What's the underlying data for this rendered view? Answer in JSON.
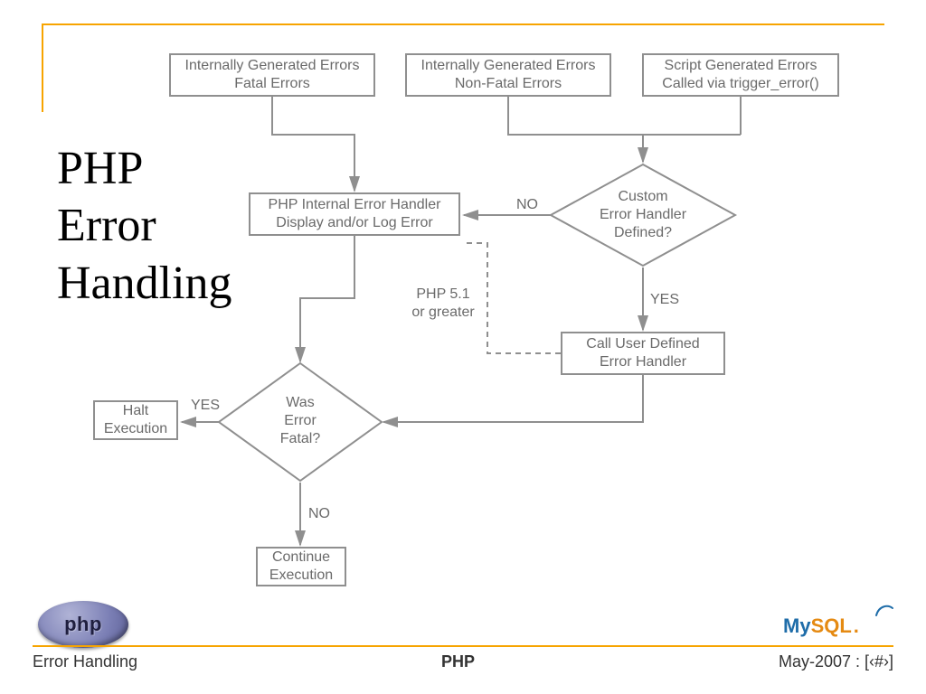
{
  "title_line1": "PHP",
  "title_line2": "Error",
  "title_line3": "Handling",
  "nodes": {
    "int_fatal_l1": "Internally Generated Errors",
    "int_fatal_l2": "Fatal Errors",
    "int_nonfatal_l1": "Internally Generated Errors",
    "int_nonfatal_l2": "Non-Fatal Errors",
    "script_l1": "Script Generated Errors",
    "script_l2": "Called via trigger_error()",
    "custom_l1": "Custom",
    "custom_l2": "Error Handler",
    "custom_l3": "Defined?",
    "internal_handler_l1": "PHP Internal Error Handler",
    "internal_handler_l2": "Display and/or Log Error",
    "call_user_l1": "Call User Defined",
    "call_user_l2": "Error Handler",
    "was_fatal_l1": "Was",
    "was_fatal_l2": "Error",
    "was_fatal_l3": "Fatal?",
    "halt": "Halt",
    "halt_l2": "Execution",
    "continue": "Continue",
    "continue_l2": "Execution"
  },
  "labels": {
    "no1": "NO",
    "yes1": "YES",
    "yes2": "YES",
    "no2": "NO",
    "php51_l1": "PHP 5.1",
    "php51_l2": "or greater"
  },
  "logos": {
    "php": "php",
    "mysql_my": "My",
    "mysql_sql": "SQL"
  },
  "footer": {
    "left": "Error Handling",
    "center": "PHP",
    "right": "May-2007 : [‹#›]"
  },
  "chart_data": {
    "type": "flowchart",
    "title": "PHP Error Handling",
    "nodes": [
      {
        "id": "n1",
        "type": "process",
        "label": "Internally Generated Errors — Fatal Errors"
      },
      {
        "id": "n2",
        "type": "process",
        "label": "Internally Generated Errors — Non-Fatal Errors"
      },
      {
        "id": "n3",
        "type": "process",
        "label": "Script Generated Errors — Called via trigger_error()"
      },
      {
        "id": "n4",
        "type": "decision",
        "label": "Custom Error Handler Defined?"
      },
      {
        "id": "n5",
        "type": "process",
        "label": "PHP Internal Error Handler — Display and/or Log Error"
      },
      {
        "id": "n6",
        "type": "process",
        "label": "Call User Defined Error Handler"
      },
      {
        "id": "n7",
        "type": "decision",
        "label": "Was Error Fatal?"
      },
      {
        "id": "n8",
        "type": "terminator",
        "label": "Halt Execution"
      },
      {
        "id": "n9",
        "type": "terminator",
        "label": "Continue Execution"
      }
    ],
    "edges": [
      {
        "from": "n1",
        "to": "n5",
        "label": ""
      },
      {
        "from": "n2",
        "to": "n4",
        "label": ""
      },
      {
        "from": "n3",
        "to": "n4",
        "label": ""
      },
      {
        "from": "n4",
        "to": "n5",
        "label": "NO"
      },
      {
        "from": "n4",
        "to": "n6",
        "label": "YES"
      },
      {
        "from": "n6",
        "to": "n5",
        "label": "PHP 5.1 or greater",
        "style": "dashed"
      },
      {
        "from": "n5",
        "to": "n7",
        "label": ""
      },
      {
        "from": "n6",
        "to": "n7",
        "label": ""
      },
      {
        "from": "n7",
        "to": "n8",
        "label": "YES"
      },
      {
        "from": "n7",
        "to": "n9",
        "label": "NO"
      }
    ]
  }
}
